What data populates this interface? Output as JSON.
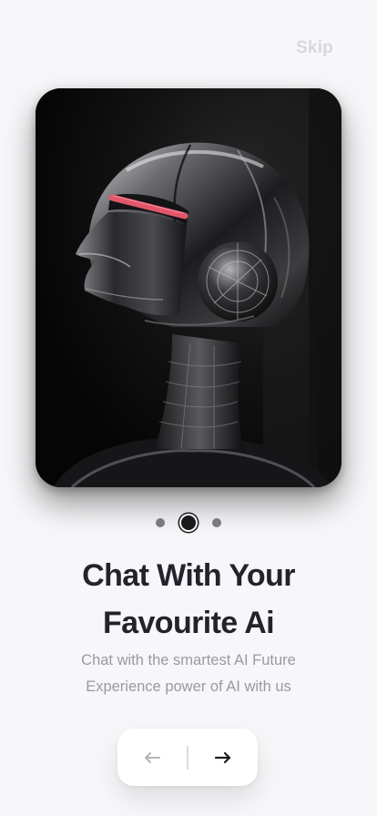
{
  "header": {
    "skip_label": "Skip"
  },
  "onboarding": {
    "title_line1": "Chat With Your",
    "title_line2": "Favourite Ai",
    "subtitle_line1": "Chat with the smartest AI Future",
    "subtitle_line2": "Experience power of AI with us",
    "page_indicator": {
      "total": 3,
      "active_index": 1
    }
  },
  "navigation": {
    "back_icon": "arrow-left-icon",
    "next_icon": "arrow-right-icon"
  },
  "colors": {
    "background": "#f7f7f9",
    "title": "#24232c",
    "subtitle": "#9a9a9e",
    "skip": "#d8d8dc",
    "accent_visor": "#e0566a"
  }
}
